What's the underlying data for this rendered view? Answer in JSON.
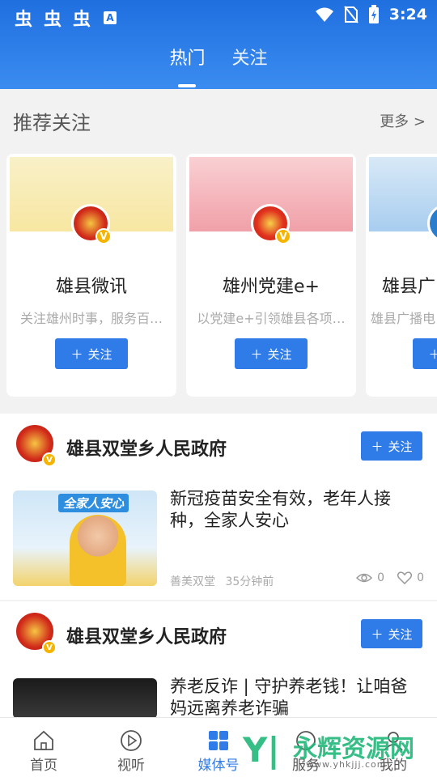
{
  "status_bar": {
    "time": "3:24",
    "left_icons": [
      "bug-icon",
      "bug-icon",
      "bug-icon",
      "a-icon"
    ],
    "right_icons": [
      "wifi-icon",
      "no-sim-icon",
      "battery-charging-icon"
    ]
  },
  "header": {
    "tabs": [
      {
        "label": "热门",
        "active": true
      },
      {
        "label": "关注",
        "active": false
      }
    ],
    "gradient_colors": [
      "#1f6fe0",
      "#3b8cf0"
    ]
  },
  "recommend": {
    "title": "推荐关注",
    "more_label": "更多 >",
    "cards": [
      {
        "name": "雄县微讯",
        "desc": "关注雄州时事，服务百…",
        "follow_label": "关注",
        "banner_color": "#fbeeb0"
      },
      {
        "name": "雄州党建e+",
        "desc": "以党建e+引领雄县各项…",
        "follow_label": "关注",
        "banner_color": "#f6b4b8"
      },
      {
        "name": "雄县广",
        "desc": "雄县广播电",
        "follow_label": "关注",
        "banner_color": "#bfd9f2"
      }
    ]
  },
  "feed": [
    {
      "author": "雄县双堂乡人民政府",
      "follow_label": "关注",
      "title": "新冠疫苗安全有效，老年人接种，全家人安心",
      "thumb_caption": "全家人安心",
      "source": "善美双堂",
      "time": "35分钟前",
      "views": "0",
      "likes": "0"
    },
    {
      "author": "雄县双堂乡人民政府",
      "follow_label": "关注",
      "title": "养老反诈 | 守护养老钱！让咱爸妈远离养老诈骗"
    }
  ],
  "bottom_nav": [
    {
      "label": "首页",
      "icon": "home-icon",
      "active": false
    },
    {
      "label": "视听",
      "icon": "play-icon",
      "active": false
    },
    {
      "label": "媒体号",
      "icon": "grid-icon",
      "active": true
    },
    {
      "label": "服务",
      "icon": "service-icon",
      "active": false
    },
    {
      "label": "我的",
      "icon": "user-icon",
      "active": false
    }
  ],
  "watermark": {
    "big": "永辉资源网",
    "small": "www.yhkjjj.com"
  },
  "accent_color": "#2f7ce8"
}
